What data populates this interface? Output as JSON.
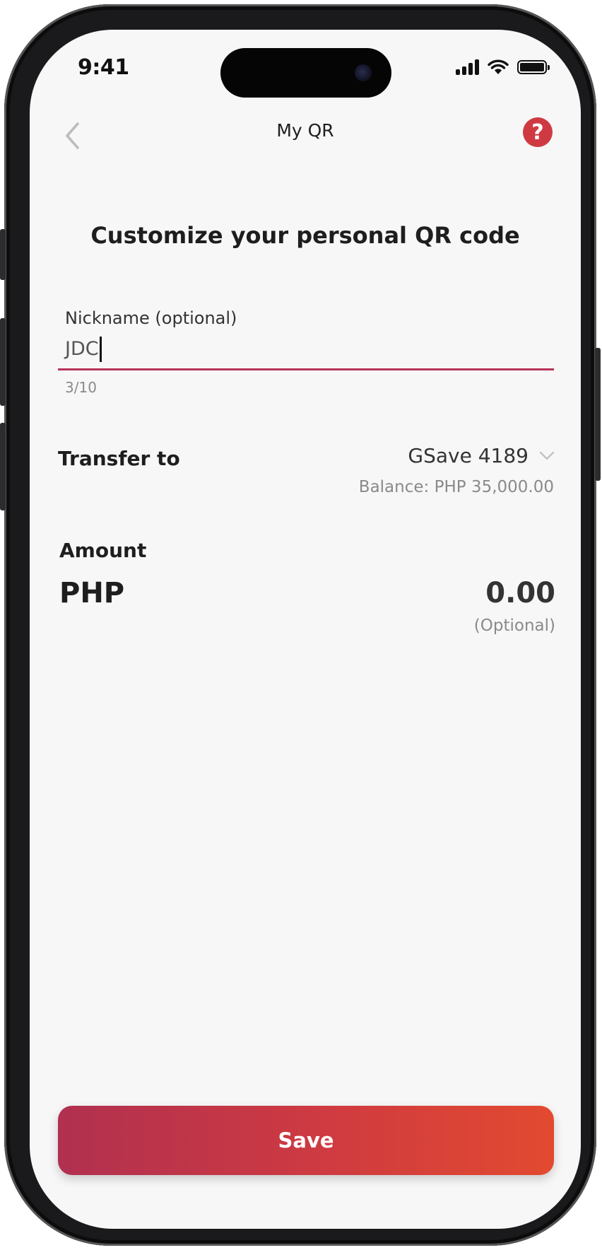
{
  "status_bar": {
    "time": "9:41",
    "icons": [
      "signal-icon",
      "wifi-icon",
      "battery-icon"
    ]
  },
  "nav": {
    "title": "My QR",
    "back_icon": "chevron-left-icon",
    "help_label": "?"
  },
  "heading": "Customize your personal QR code",
  "nickname": {
    "label": "Nickname (optional)",
    "value": "JDC",
    "counter": "3/10"
  },
  "transfer": {
    "label": "Transfer to",
    "account": "GSave 4189",
    "balance": "Balance: PHP 35,000.00",
    "dropdown_icon": "chevron-down-icon"
  },
  "amount": {
    "label": "Amount",
    "currency": "PHP",
    "value": "0.00",
    "hint": "(Optional)"
  },
  "save_button": {
    "label": "Save"
  },
  "colors": {
    "accent": "#b83458",
    "help": "#cf3a42",
    "button_gradient_start": "#b13050",
    "button_gradient_end": "#e24a30",
    "background": "#f7f7f8"
  }
}
